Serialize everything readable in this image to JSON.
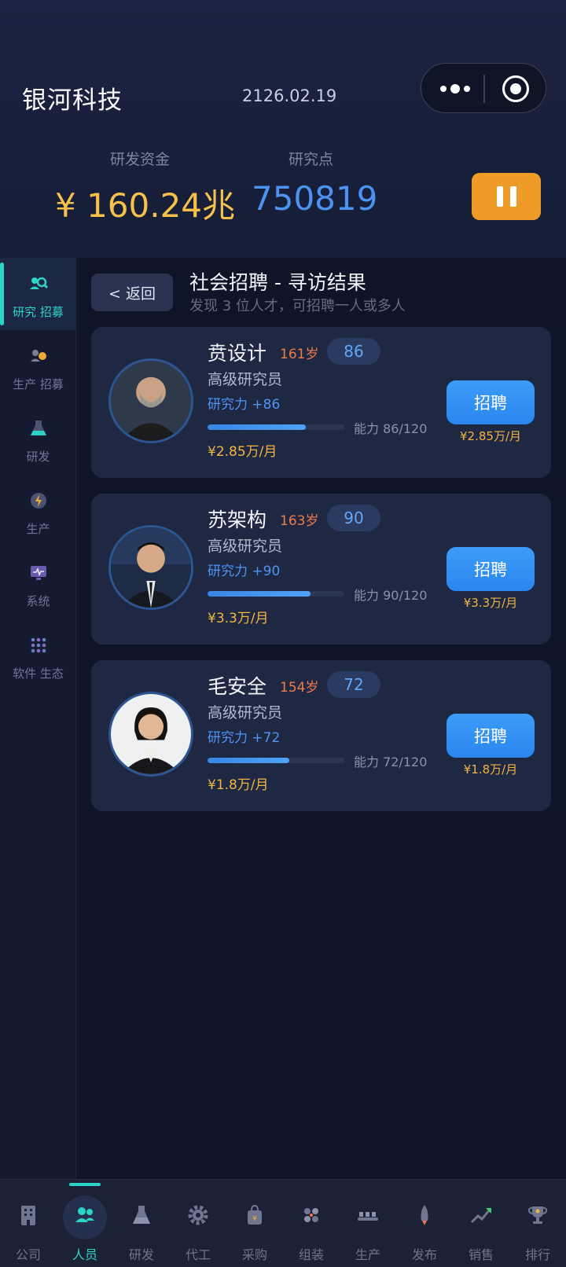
{
  "header": {
    "company": "银河科技",
    "date": "2126.02.19",
    "funds_label": "研发资金",
    "funds_value": "¥ 160.24兆",
    "points_label": "研究点",
    "points_value": "750819"
  },
  "sidebar": {
    "items": [
      {
        "label": "研究 招募",
        "icon": "research-recruit-icon",
        "active": true
      },
      {
        "label": "生产 招募",
        "icon": "production-recruit-icon"
      },
      {
        "label": "研发",
        "icon": "flask-icon"
      },
      {
        "label": "生产",
        "icon": "power-icon"
      },
      {
        "label": "系统",
        "icon": "monitor-icon"
      },
      {
        "label": "软件 生态",
        "icon": "grid-dots-icon"
      }
    ]
  },
  "page": {
    "back_label": "< 返回",
    "title": "社会招聘 - 寻访结果",
    "subtitle": "发现 3 位人才，可招聘一人或多人"
  },
  "candidates": [
    {
      "name": "贲设计",
      "age": "161岁",
      "score": "86",
      "title": "高级研究员",
      "power": "研究力 +86",
      "ability_text": "能力 86/120",
      "ability": 86,
      "ability_max": 120,
      "salary": "¥2.85万/月",
      "hire_label": "招聘",
      "hire_cost": "¥2.85万/月"
    },
    {
      "name": "苏架构",
      "age": "163岁",
      "score": "90",
      "title": "高级研究员",
      "power": "研究力 +90",
      "ability_text": "能力 90/120",
      "ability": 90,
      "ability_max": 120,
      "salary": "¥3.3万/月",
      "hire_label": "招聘",
      "hire_cost": "¥3.3万/月"
    },
    {
      "name": "毛安全",
      "age": "154岁",
      "score": "72",
      "title": "高级研究员",
      "power": "研究力 +72",
      "ability_text": "能力 72/120",
      "ability": 72,
      "ability_max": 120,
      "salary": "¥1.8万/月",
      "hire_label": "招聘",
      "hire_cost": "¥1.8万/月"
    }
  ],
  "tabbar": {
    "tabs": [
      {
        "label": "公司",
        "icon": "building-icon"
      },
      {
        "label": "人员",
        "icon": "people-icon",
        "active": true
      },
      {
        "label": "研发",
        "icon": "flask-icon"
      },
      {
        "label": "代工",
        "icon": "gear-icon"
      },
      {
        "label": "采购",
        "icon": "shopping-bag-icon"
      },
      {
        "label": "组装",
        "icon": "assemble-icon"
      },
      {
        "label": "生产",
        "icon": "conveyor-icon"
      },
      {
        "label": "发布",
        "icon": "rocket-icon"
      },
      {
        "label": "销售",
        "icon": "chart-up-icon"
      },
      {
        "label": "排行",
        "icon": "trophy-icon"
      }
    ]
  },
  "colors": {
    "accent": "#2bd3c8",
    "gold": "#f6c04a",
    "blue": "#4c93f0",
    "pause": "#ee9c27",
    "age": "#f07a4a"
  }
}
